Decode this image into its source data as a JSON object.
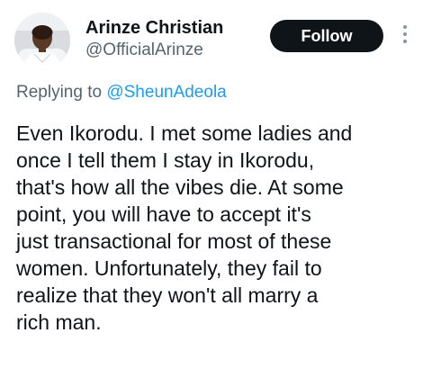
{
  "author": {
    "name": "Arinze Christian",
    "handle": "@OfficialArinze",
    "avatar_icon": "user-avatar-photo"
  },
  "actions": {
    "follow_label": "Follow",
    "more_icon": "more-vertical-icon"
  },
  "reply": {
    "prefix": "Replying to ",
    "mention": "@SheunAdeola"
  },
  "tweet": {
    "text": "Even Ikorodu. I met some ladies and\nonce I tell them I stay in Ikorodu,\nthat's how all the vibes die. At some\npoint, you will have to accept it's\njust transactional for most of these\nwomen. Unfortunately, they fail to\nrealize that they won't all marry a\nrich man."
  },
  "colors": {
    "follow_bg": "#0f1419",
    "mention": "#1d9bf0",
    "secondary_text": "#536471"
  }
}
